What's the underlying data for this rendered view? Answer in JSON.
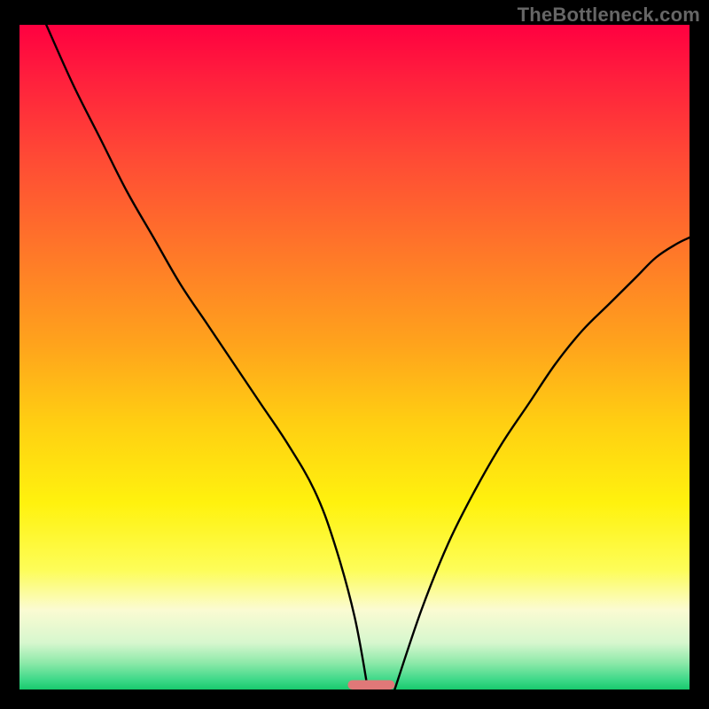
{
  "watermark": "TheBottleneck.com",
  "chart_data": {
    "type": "line",
    "title": "",
    "xlabel": "",
    "ylabel": "",
    "xlim": [
      0,
      100
    ],
    "ylim": [
      0,
      100
    ],
    "background_gradient": {
      "stops": [
        {
          "offset": 0.0,
          "color": "#ff0040"
        },
        {
          "offset": 0.08,
          "color": "#ff1f3d"
        },
        {
          "offset": 0.2,
          "color": "#ff4a35"
        },
        {
          "offset": 0.35,
          "color": "#ff7a28"
        },
        {
          "offset": 0.48,
          "color": "#ffa31c"
        },
        {
          "offset": 0.6,
          "color": "#ffcf12"
        },
        {
          "offset": 0.72,
          "color": "#fff20e"
        },
        {
          "offset": 0.82,
          "color": "#fdfd58"
        },
        {
          "offset": 0.88,
          "color": "#fbfbd2"
        },
        {
          "offset": 0.93,
          "color": "#d6f7ce"
        },
        {
          "offset": 0.96,
          "color": "#8de9a9"
        },
        {
          "offset": 0.985,
          "color": "#3fd989"
        },
        {
          "offset": 1.0,
          "color": "#18c96d"
        }
      ]
    },
    "series": [
      {
        "name": "bottleneck-curve",
        "color": "#000000",
        "x": [
          4,
          8,
          12,
          16,
          20,
          24,
          28,
          32,
          36,
          40,
          44,
          47,
          50,
          52,
          56,
          60,
          64,
          68,
          72,
          76,
          80,
          84,
          88,
          92,
          95,
          98,
          100
        ],
        "y": [
          100,
          91,
          83,
          75,
          68,
          61,
          55,
          49,
          43,
          37,
          30,
          22,
          11,
          0,
          0,
          12,
          22,
          30,
          37,
          43,
          49,
          54,
          58,
          62,
          65,
          67,
          68
        ]
      }
    ],
    "marker": {
      "name": "optimal-range",
      "color": "#e07878",
      "x_center": 52.5,
      "width": 7,
      "y": 0.7,
      "height": 1.4,
      "rx": 0.9
    }
  }
}
